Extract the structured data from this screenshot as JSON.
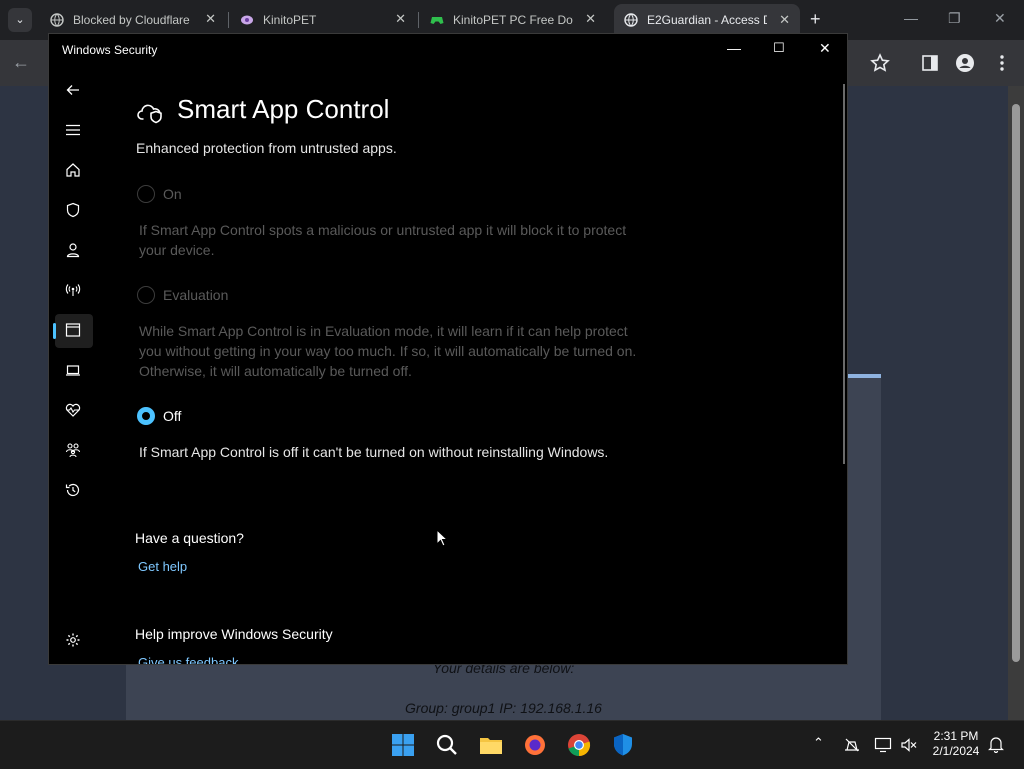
{
  "browser": {
    "tabs": [
      {
        "title": "Blocked by Cloudflare",
        "favicon": "globe-icon"
      },
      {
        "title": "KinitoPET",
        "favicon": "kinito-icon"
      },
      {
        "title": "KinitoPET PC Free Dow",
        "favicon": "gamepad-icon"
      },
      {
        "title": "E2Guardian - Access D",
        "favicon": "globe-icon"
      }
    ],
    "active_tab": 3
  },
  "webpage": {
    "details_text": "Your details are below:",
    "group_ip_text": "Group: group1   IP: 192.168.1.16"
  },
  "window": {
    "title": "Windows Security"
  },
  "nav_icons": [
    "back-arrow-icon",
    "hamburger-icon",
    "home-icon",
    "shield-icon",
    "person-icon",
    "wifi-antenna-icon",
    "app-browser-icon",
    "laptop-icon",
    "heart-pulse-icon",
    "family-icon",
    "history-icon",
    "settings-gear-icon"
  ],
  "page": {
    "title": "Smart App Control",
    "subtitle": "Enhanced protection from untrusted apps.",
    "options": [
      {
        "label": "On",
        "description": "If Smart App Control spots a malicious or untrusted app it will block it to protect your device.",
        "checked": false,
        "enabled": false
      },
      {
        "label": "Evaluation",
        "description": "While Smart App Control is in Evaluation mode, it will learn if it can help protect you without getting in your way too much. If so, it will automatically be turned on. Otherwise, it will automatically be turned off.",
        "checked": false,
        "enabled": false
      },
      {
        "label": "Off",
        "description": "If Smart App Control is off it can't be turned on without reinstalling Windows.",
        "checked": true,
        "enabled": true
      }
    ],
    "question_heading": "Have a question?",
    "get_help_link": "Get help",
    "improve_heading": "Help improve Windows Security",
    "feedback_link": "Give us feedback"
  },
  "taskbar": {
    "apps": [
      "windows-start-icon",
      "search-icon",
      "file-explorer-icon",
      "firefox-icon",
      "chrome-icon",
      "windows-security-icon"
    ],
    "time": "2:31 PM",
    "date": "2/1/2024"
  },
  "colors": {
    "accent": "#4cc2ff",
    "window_bg": "#000000",
    "link": "#7fc8ff"
  }
}
